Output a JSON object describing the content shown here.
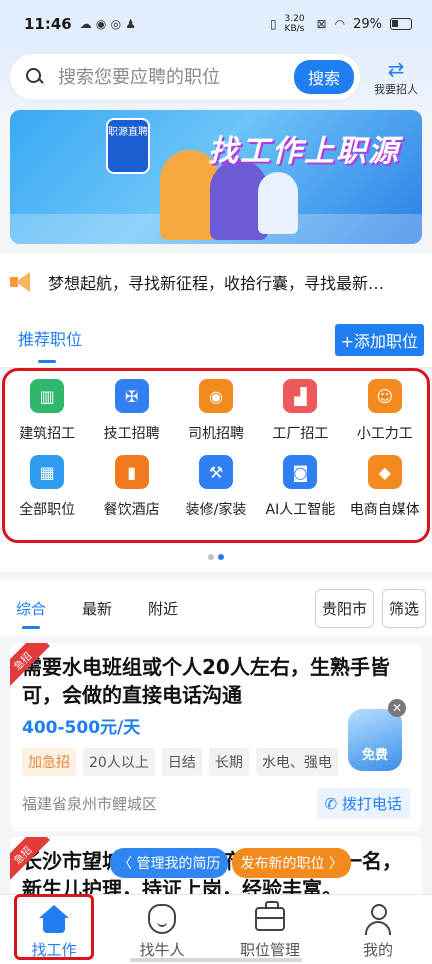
{
  "status_bar": {
    "time": "11:46",
    "speed": "3.20 KB/s",
    "battery": "29%"
  },
  "search": {
    "placeholder": "搜索您要应聘的职位",
    "button": "搜索"
  },
  "recruit_label": "我要招人",
  "banner": {
    "app_badge": "职源直聘",
    "slogan": "找工作上职源"
  },
  "notice_text": "梦想起航，寻找新征程，收拾行囊，寻找最新…",
  "recommend": {
    "tab": "推荐职位",
    "add_button": "+添加职位"
  },
  "categories": [
    {
      "label": "建筑招工",
      "icon": "building-icon",
      "color": "#2fb76c"
    },
    {
      "label": "技工招聘",
      "icon": "tools-icon",
      "color": "#2f7ff0"
    },
    {
      "label": "司机招聘",
      "icon": "driver-icon",
      "color": "#f28a1e"
    },
    {
      "label": "工厂招工",
      "icon": "factory-icon",
      "color": "#ee5a5a"
    },
    {
      "label": "小工力工",
      "icon": "worker-icon",
      "color": "#f28a1e"
    },
    {
      "label": "全部职位",
      "icon": "grid-icon",
      "color": "#2f9cf0"
    },
    {
      "label": "餐饮酒店",
      "icon": "restaurant-icon",
      "color": "#f27a1e"
    },
    {
      "label": "装修/家装",
      "icon": "renovation-icon",
      "color": "#2f7ff0"
    },
    {
      "label": "AI人工智能",
      "icon": "robot-icon",
      "color": "#2f7ff0"
    },
    {
      "label": "电商自媒体",
      "icon": "box-icon",
      "color": "#f28a1e"
    }
  ],
  "filters": {
    "tabs": [
      "综合",
      "最新",
      "附近"
    ],
    "city": "贵阳市",
    "filter": "筛选"
  },
  "jobs": [
    {
      "ribbon": "急招",
      "title": "需要水电班组或个人20人左右，生熟手皆可，会做的直接电话沟通",
      "salary": "400-500元/天",
      "tags": [
        "加急招",
        "20人以上",
        "日结",
        "长期",
        "水电、强电"
      ],
      "location": "福建省泉州市鲤城区",
      "call": "拨打电话",
      "free_badge": "免费"
    },
    {
      "ribbon": "急招",
      "title": "长沙市望城区湾田望江府需要催乳师一名，新生儿护理，持证上岗，经验丰富。"
    }
  ],
  "floating": {
    "resume": "〈 管理我的简历",
    "post": "发布新的职位 〉"
  },
  "tabbar": [
    "找工作",
    "找牛人",
    "职位管理",
    "我的"
  ]
}
